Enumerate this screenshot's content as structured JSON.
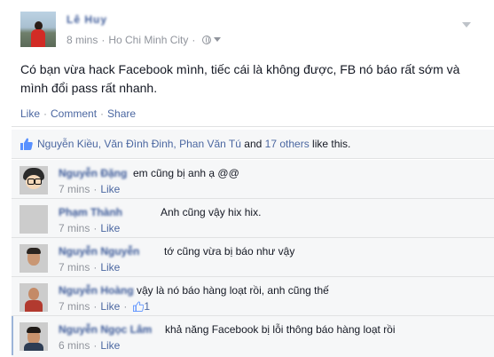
{
  "post": {
    "author_name": "Lê Huy",
    "timestamp": "8 mins",
    "location": "Ho Chi Minh City",
    "separator": "·",
    "privacy_icon": "globe-icon",
    "text": "Có bạn vừa hack Facebook mình, tiếc cái là không được, FB nó báo rất sớm và mình đổi pass rất nhanh."
  },
  "actions": {
    "like": "Like",
    "comment": "Comment",
    "share": "Share",
    "sep": "·"
  },
  "likes": {
    "names": "Nguyễn Kiều, Văn Đình Đinh, Phan Văn Tú",
    "and": "and",
    "others": "17 others",
    "suffix": "like this."
  },
  "comments": [
    {
      "name": "Nguyễn Đặng",
      "text": "em cũng bị anh ạ @@",
      "time": "7 mins",
      "like": "Like",
      "likes_count": ""
    },
    {
      "name": "Phạm Thành",
      "text": "Anh cũng vậy hix hix.",
      "time": "7 mins",
      "like": "Like",
      "likes_count": ""
    },
    {
      "name": "Nguyễn Nguyễn",
      "text": "tớ cũng vừa bị báo như vậy",
      "time": "7 mins",
      "like": "Like",
      "likes_count": ""
    },
    {
      "name": "Nguyễn Hoàng",
      "text": "vậy là nó báo hàng loạt rồi, anh cũng thế",
      "time": "7 mins",
      "like": "Like",
      "likes_count": "1"
    },
    {
      "name": "Nguyễn Ngọc Lâm",
      "text": "khả năng Facebook bị lỗi thông báo hàng loạt rồi",
      "time": "6 mins",
      "like": "Like",
      "likes_count": ""
    }
  ],
  "colors": {
    "link": "#4b67a1",
    "name": "#3b5998",
    "meta": "#90949c",
    "panel": "#f6f7f8"
  }
}
